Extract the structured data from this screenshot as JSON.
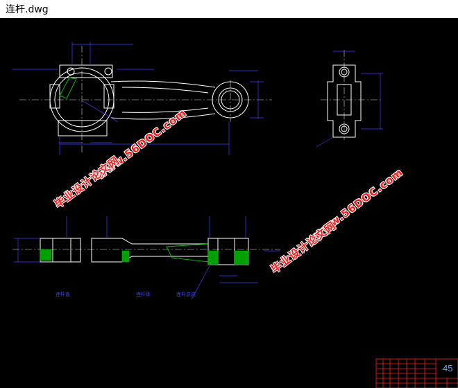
{
  "window": {
    "title": "连杆.dwg"
  },
  "drawing": {
    "watermarks": {
      "site": "www.56DOC.com",
      "cn": "毕业设计论文网"
    },
    "view_labels": {
      "left": "连杆盖",
      "middle": "连杆体",
      "right": "连杆总成"
    },
    "material_label": "45",
    "colors": {
      "outline": "#ffffff",
      "dimension": "#4040ff",
      "centerline": "#ffffff",
      "hatch": "#00c000",
      "watermark": "#ff1a1a",
      "titleblock": "#ff2020"
    }
  }
}
